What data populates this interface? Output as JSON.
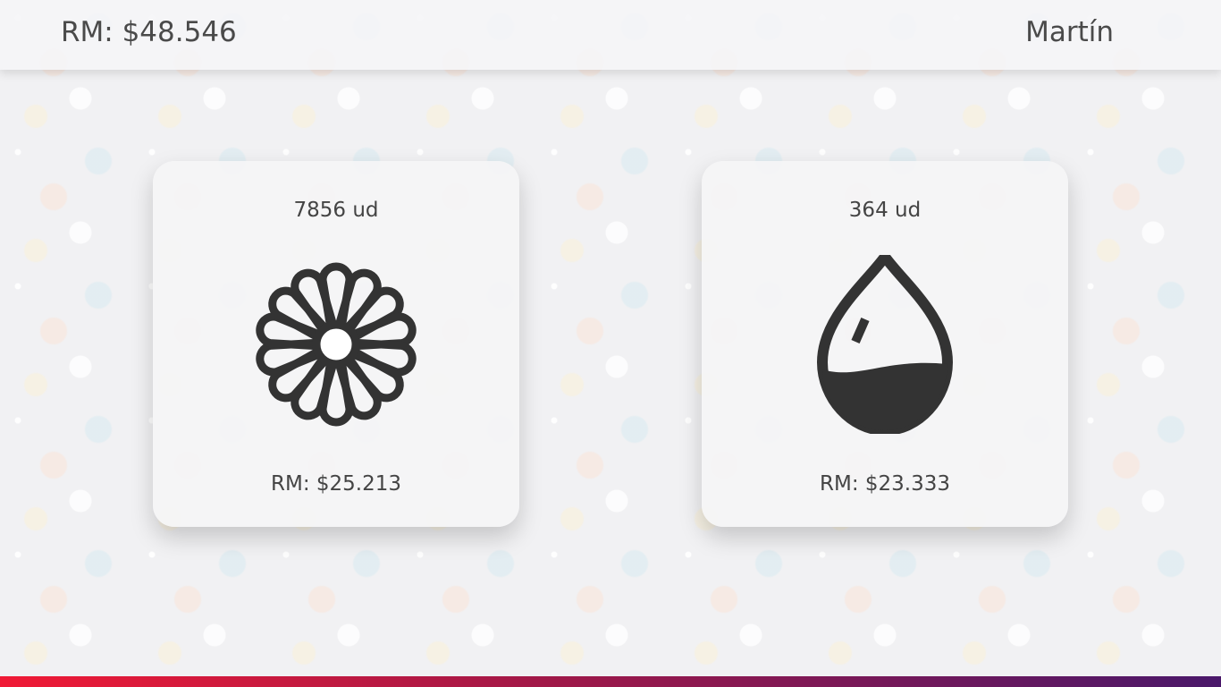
{
  "header": {
    "total": "RM: $48.546",
    "user": "Martín"
  },
  "cards": [
    {
      "quantity": "7856 ud",
      "icon": "flower-icon",
      "price": "RM: $25.213"
    },
    {
      "quantity": "364 ud",
      "icon": "water-drop-icon",
      "price": "RM: $23.333"
    }
  ],
  "colors": {
    "bar_start": "#f01a35",
    "bar_end": "#4a186a",
    "icon": "#333333"
  }
}
